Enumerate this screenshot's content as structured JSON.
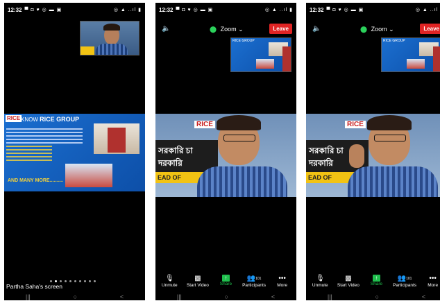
{
  "status": {
    "time": "12:32",
    "notif_icons": "▀ ◘ ♥ ◎ ▬ ▣",
    "sys_icons": "◎ ▲ ..ıl ▮"
  },
  "zoom": {
    "speaker_icon": "🔈",
    "label": "Zoom",
    "chevron": "⌄",
    "secure_icon": "⬤",
    "leave_label": "Leave"
  },
  "slide": {
    "logo": "RICE",
    "title_prefix": "KNOW",
    "title_main": "RICE GROUP",
    "more": "AND MANY MORE.........."
  },
  "camera": {
    "rice_sign": "RICE",
    "banner_text": "সরকারি চা দরকারি",
    "yellow_text": "EAD OF"
  },
  "screen_share": {
    "label": "Partha Saha's screen",
    "page_dots": 10,
    "active_dot": 1
  },
  "toolbar": {
    "unmute": "Unmute",
    "unmute_icon": "🎙",
    "start_video": "Start Video",
    "video_icon": "▩",
    "share": "Share",
    "share_icon": "↑",
    "participants": "Participants",
    "participants_icon": "👥",
    "participants_count": "101",
    "more": "More",
    "more_icon": "•••"
  },
  "navbar": {
    "recents": "|||",
    "home": "○",
    "back": "<"
  },
  "colors": {
    "leave": "#e02424",
    "share": "#1fbf4d",
    "secure": "#2bd15b"
  }
}
